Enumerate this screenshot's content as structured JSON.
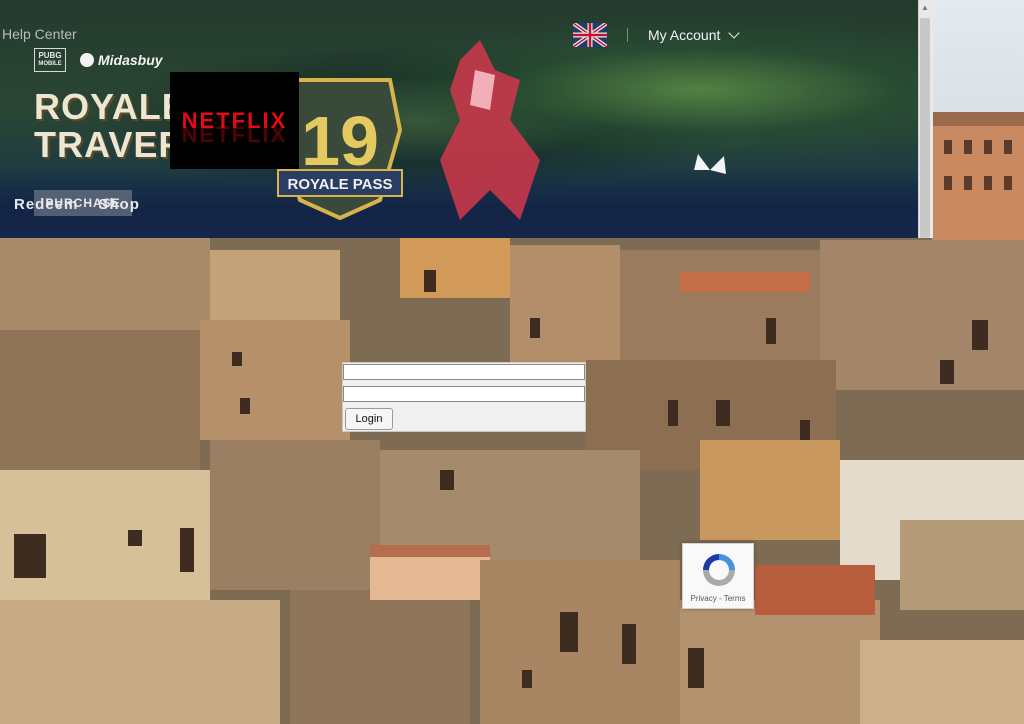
{
  "header": {
    "help_center": "Help Center",
    "pubg_logo_text": [
      "PUBG",
      "MOBILE"
    ],
    "midasbuy_label": "Midasbuy",
    "account_label": "My Account",
    "region_flag_icon": "flag-icon"
  },
  "banner": {
    "title_line1": "ROYALE PASS",
    "title_line2": "TRAVERSE",
    "season_number": "19",
    "season_label": "ROYALE PASS",
    "netflix_logo": "NETFLIX",
    "purchase_label": "PURCHASE"
  },
  "nav": {
    "items": [
      "Redeem",
      "Shop"
    ]
  },
  "login_form": {
    "username_value": "",
    "password_value": "",
    "login_label": "Login"
  },
  "recaptcha": {
    "privacy": "Privacy",
    "separator": " - ",
    "terms": "Terms"
  },
  "colors": {
    "banner_dark": "#15264a",
    "accent_gold": "#d8b24a",
    "netflix_red": "#e50914"
  }
}
